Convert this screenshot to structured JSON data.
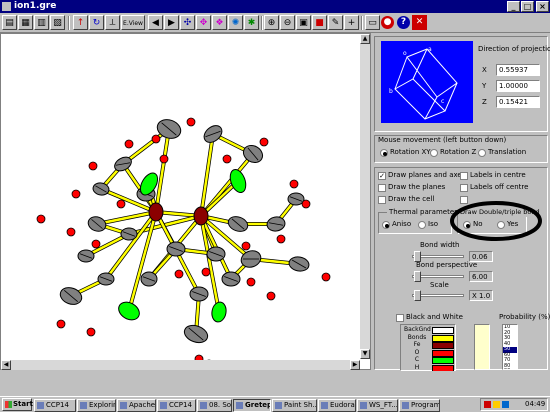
{
  "window": {
    "title": "ion1.gre",
    "btn_min": "_",
    "btn_max": "□",
    "btn_close": "×"
  },
  "toolbar": {
    "view_label": "E.View",
    "help": "?"
  },
  "projection": {
    "title": "Direction of projection",
    "x_label": "X",
    "x_value": "0.55937",
    "y_label": "Y",
    "y_value": "1.00000",
    "z_label": "Z",
    "z_value": "0.15421",
    "cube_labels": {
      "a": "a",
      "b": "b",
      "c": "c",
      "o": "o"
    }
  },
  "mouse": {
    "title": "Mouse movement (left button down)",
    "options": [
      "Rotation XY",
      "Rotation Z",
      "Translation"
    ],
    "selected": 0
  },
  "draw_options": {
    "planes_axes": "Draw planes and axes",
    "planes": "Draw the planes",
    "cell": "Draw the cell",
    "labels_centre": "Labels in centre",
    "labels_off": "Labels off centre"
  },
  "thermal": {
    "title": "Thermal parameters",
    "aniso": "Aniso",
    "iso": "Iso"
  },
  "bond_type": {
    "title": "Draw Double/triple bond",
    "no": "No",
    "yes": "Yes"
  },
  "bond_width": {
    "label": "Bond width",
    "value": "0.06"
  },
  "bond_perspective": {
    "label": "Bond perspective",
    "value": "6.00"
  },
  "scale": {
    "label": "Scale",
    "value": "X 1.0"
  },
  "bw": {
    "label": "Black and White"
  },
  "colors": {
    "rows": [
      "BackGnd",
      "Bonds",
      "Fe",
      "O",
      "C",
      "H"
    ],
    "swatches": [
      "#ffffff",
      "#ffff00",
      "#8b0000",
      "#ff0000",
      "#00ff00",
      "#ff0000"
    ]
  },
  "probability": {
    "label": "Probability (%)",
    "values": [
      "10",
      "20",
      "30",
      "40",
      "50",
      "60",
      "70",
      "80",
      "90"
    ],
    "selected": "50"
  },
  "taskbar": {
    "start": "Start",
    "items": [
      "CCP14",
      "Explorin...",
      "Apache",
      "CCP14",
      "08. Sort...",
      "Gretep",
      "Paint Sh...",
      "Eudora",
      "WS_FT...",
      "Program..."
    ],
    "clock": "04:49"
  },
  "molecule_colors": {
    "iron": "#8b0000",
    "oxygen": "#ff0000",
    "carbon": "#00ff00",
    "hydrogen": "#ff0000",
    "bond": "#ffff00",
    "ellipsoid": "#808080"
  }
}
